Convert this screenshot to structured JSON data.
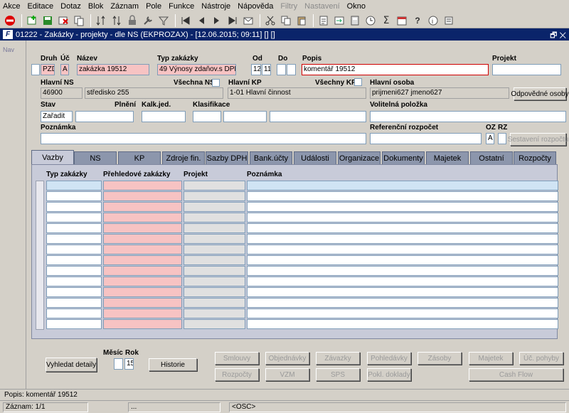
{
  "menu": [
    "Akce",
    "Editace",
    "Dotaz",
    "Blok",
    "Záznam",
    "Pole",
    "Funkce",
    "Nástroje",
    "Nápověda",
    "Filtry",
    "Nastavení",
    "Okno"
  ],
  "window": {
    "title": "01222 - Zakázky - projekty - dle NS (EKPROZAX) - [12.06.2015; 09:11] [] []",
    "buttons": "🗗 ✕"
  },
  "nav": {
    "label": "Nav"
  },
  "form": {
    "druh_label": "Druh",
    "uc_label": "Úč",
    "nazev_label": "Název",
    "typ_label": "Typ zakázky",
    "od_label": "Od",
    "do_label": "Do",
    "popis_label": "Popis",
    "projekt_label": "Projekt",
    "druh_value": "PZD",
    "uc_value": "A",
    "nazev_value": "zakázka 19512",
    "typ_value": "49 Výnosy zdaňov.s DPH",
    "od_value": "12",
    "od_value2": "11",
    "popis_value": "komentář 19512",
    "hlavni_ns_label": "Hlavní NS",
    "vsechna_ns_label": "Všechna NS",
    "hlavni_kp_label": "Hlavní KP",
    "vsechny_kp_label": "Všechny KP",
    "hlavni_osoba_label": "Hlavní osoba",
    "ns_code": "46900",
    "ns_name": "středisko 255",
    "kp_value": "1-01 Hlavní činnost",
    "osoba_value": "prijmeni627 jmeno627",
    "odpovedne_button": "Odpovědné osoby",
    "stav_label": "Stav",
    "plneni_label": "Plnění",
    "kalk_label": "Kalk.jed.",
    "klasif_label": "Klasifikace",
    "volitelna_label": "Volitelná položka",
    "stav_value": "Zařadit",
    "poznamka_label": "Poznámka",
    "ref_label": "Referenční rozpočet",
    "oz_label": "OZ",
    "rz_label": "RZ",
    "oz_value": "A",
    "sestaveni_button": "Sestavení rozpočtu"
  },
  "tabs": [
    "Vazby",
    "NS",
    "KP",
    "Zdroje fin.",
    "Sazby DPH",
    "Bank.účty",
    "Události",
    "Organizace",
    "Dokumenty",
    "Majetek",
    "Ostatní",
    "Rozpočty"
  ],
  "grid": {
    "headers": [
      "Typ zakázky",
      "Přehledové zakázky",
      "Projekt",
      "Poznámka"
    ]
  },
  "bottom": {
    "vyhledat": "Vyhledat detaily",
    "mesic_label": "Měsíc",
    "rok_label": "Rok",
    "rok_value": "15",
    "historie": "Historie",
    "row1": [
      "Smlouvy",
      "Objednávky",
      "Závazky",
      "Pohledávky",
      "Zásoby",
      "Majetek",
      "Úč. pohyby"
    ],
    "row2": [
      "Rozpočty",
      "VZM",
      "SPS",
      "Pokl. doklady",
      "Cash Flow"
    ]
  },
  "status": {
    "line1": "Popis: komentář 19512",
    "record": "Záznam: 1/1",
    "seg2": "...",
    "osc": "<OSC>"
  }
}
